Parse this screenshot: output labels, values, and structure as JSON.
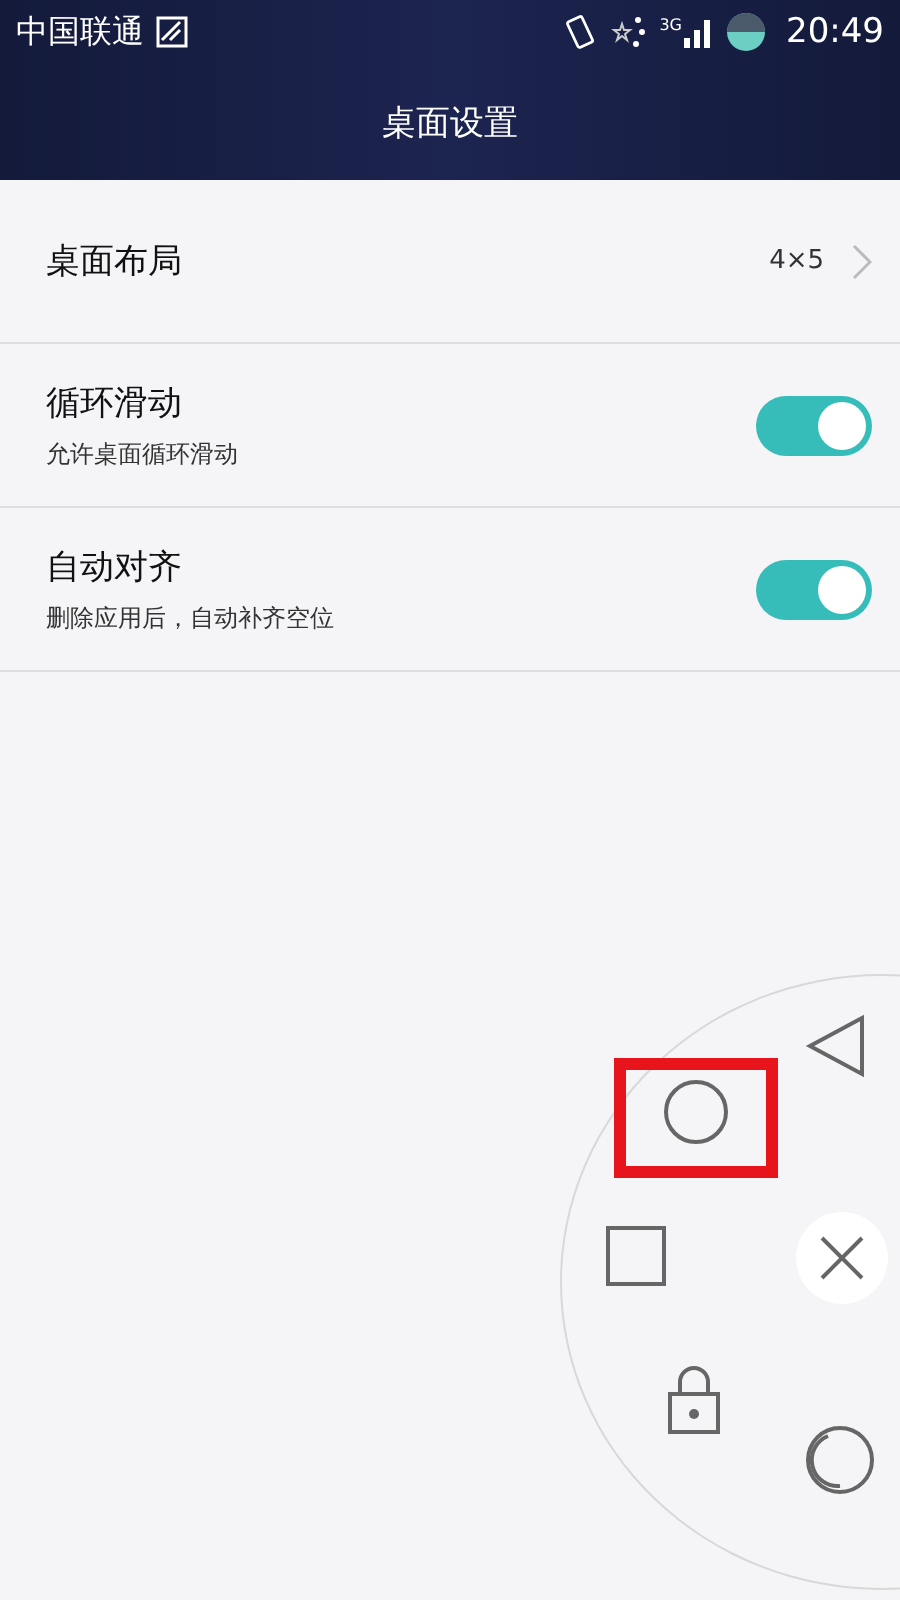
{
  "status_bar": {
    "carrier": "中国联通",
    "network": "3G",
    "time": "20:49"
  },
  "title": "桌面设置",
  "rows": [
    {
      "kind": "value",
      "title": "桌面布局",
      "value": "4×5"
    },
    {
      "kind": "toggle",
      "title": "循环滑动",
      "subtitle": "允许桌面循环滑动",
      "on": true
    },
    {
      "kind": "toggle",
      "title": "自动对齐",
      "subtitle": "删除应用后，自动补齐空位",
      "on": true
    }
  ],
  "nav_ring": {
    "buttons": [
      {
        "kind": "back",
        "highlighted": false
      },
      {
        "kind": "home",
        "highlighted": true
      },
      {
        "kind": "recent",
        "highlighted": false
      },
      {
        "kind": "close",
        "highlighted": false
      },
      {
        "kind": "lock",
        "highlighted": false
      },
      {
        "kind": "screenshot",
        "highlighted": false
      }
    ]
  }
}
